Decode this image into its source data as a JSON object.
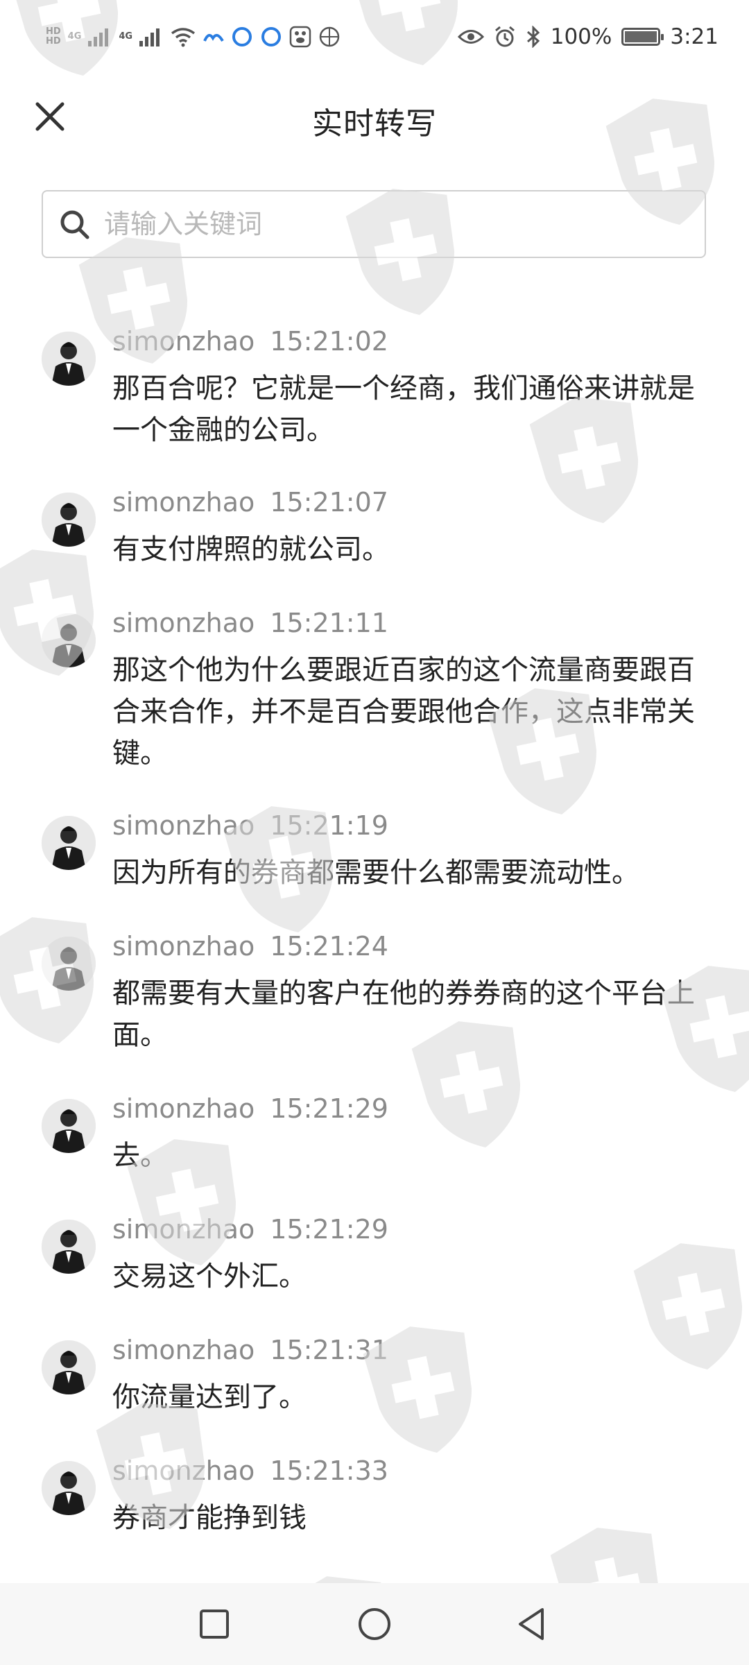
{
  "status_bar": {
    "hd1": "HD",
    "hd2": "HD",
    "net1": "4G",
    "net2": "4G",
    "battery_percent_text": "100%",
    "battery_level": 1.0,
    "time": "3:21",
    "icons": [
      "signal-icon",
      "signal-icon",
      "wifi-icon",
      "app-icon",
      "app-icon",
      "app-icon",
      "paw-icon",
      "ball-icon",
      "eye-icon",
      "alarm-icon",
      "bluetooth-icon",
      "battery-icon"
    ]
  },
  "header": {
    "title": "实时转写",
    "close_icon": "close-icon"
  },
  "search": {
    "placeholder": "请输入关键词",
    "value": "",
    "icon": "search-icon"
  },
  "messages": [
    {
      "speaker": "simonzhao",
      "time": "15:21:02",
      "text": "那百合呢？它就是一个经商，我们通俗来讲就是一个金融的公司。"
    },
    {
      "speaker": "simonzhao",
      "time": "15:21:07",
      "text": "有支付牌照的就公司。"
    },
    {
      "speaker": "simonzhao",
      "time": "15:21:11",
      "text": "那这个他为什么要跟近百家的这个流量商要跟百合来合作，并不是百合要跟他合作，这点非常关键。"
    },
    {
      "speaker": "simonzhao",
      "time": "15:21:19",
      "text": "因为所有的券商都需要什么都需要流动性。"
    },
    {
      "speaker": "simonzhao",
      "time": "15:21:24",
      "text": "都需要有大量的客户在他的券券商的这个平台上面。"
    },
    {
      "speaker": "simonzhao",
      "time": "15:21:29",
      "text": "去。"
    },
    {
      "speaker": "simonzhao",
      "time": "15:21:29",
      "text": "交易这个外汇。"
    },
    {
      "speaker": "simonzhao",
      "time": "15:21:31",
      "text": "你流量达到了。"
    },
    {
      "speaker": "simonzhao",
      "time": "15:21:33",
      "text": "券商才能挣到钱"
    }
  ],
  "nav_bar": {
    "icons": [
      "recents-square-icon",
      "home-circle-icon",
      "back-triangle-icon"
    ]
  },
  "colors": {
    "text_primary": "#222222",
    "text_secondary": "#8a8a8a",
    "placeholder": "#b8b8b8",
    "border": "#cfcfcf",
    "watermark": "#d9d9d9"
  }
}
